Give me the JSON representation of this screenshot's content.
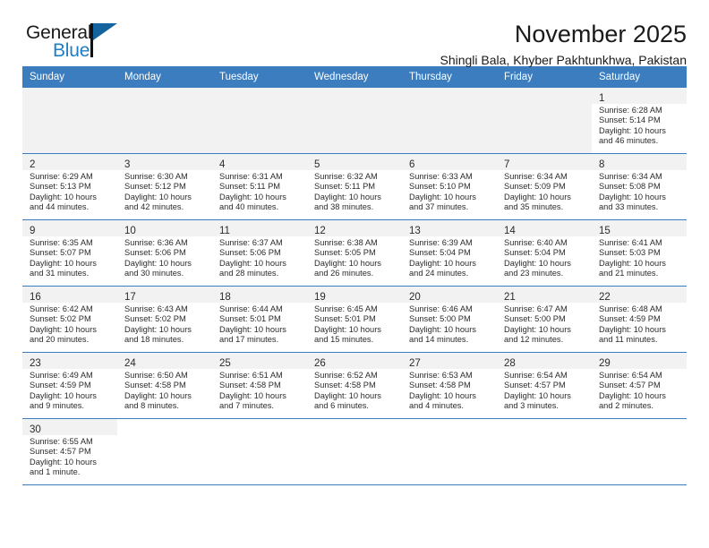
{
  "brand": {
    "word_one": "General",
    "word_two": "Blue",
    "flag_icon": "triangle-flag-icon",
    "colors": {
      "black": "#1a1a1a",
      "blue": "#1f7ec4",
      "flag": "#14639e"
    }
  },
  "header": {
    "title": "November 2025",
    "subtitle": "Shingli Bala, Khyber Pakhtunkhwa, Pakistan"
  },
  "theme": {
    "header_band": "#3b7dbf",
    "row_divider": "#3b7dbf",
    "daynum_strip": "#f2f2f2"
  },
  "weekdays": [
    "Sunday",
    "Monday",
    "Tuesday",
    "Wednesday",
    "Thursday",
    "Friday",
    "Saturday"
  ],
  "labels": {
    "sunrise_prefix": "Sunrise:",
    "sunset_prefix": "Sunset:",
    "daylight_prefix": "Daylight:"
  },
  "weeks": [
    [
      {
        "empty": true
      },
      {
        "empty": true
      },
      {
        "empty": true
      },
      {
        "empty": true
      },
      {
        "empty": true
      },
      {
        "empty": true
      },
      {
        "day": "1",
        "sunrise": "Sunrise: 6:28 AM",
        "sunset": "Sunset: 5:14 PM",
        "daylight_line1": "Daylight: 10 hours",
        "daylight_line2": "and 46 minutes."
      }
    ],
    [
      {
        "day": "2",
        "sunrise": "Sunrise: 6:29 AM",
        "sunset": "Sunset: 5:13 PM",
        "daylight_line1": "Daylight: 10 hours",
        "daylight_line2": "and 44 minutes."
      },
      {
        "day": "3",
        "sunrise": "Sunrise: 6:30 AM",
        "sunset": "Sunset: 5:12 PM",
        "daylight_line1": "Daylight: 10 hours",
        "daylight_line2": "and 42 minutes."
      },
      {
        "day": "4",
        "sunrise": "Sunrise: 6:31 AM",
        "sunset": "Sunset: 5:11 PM",
        "daylight_line1": "Daylight: 10 hours",
        "daylight_line2": "and 40 minutes."
      },
      {
        "day": "5",
        "sunrise": "Sunrise: 6:32 AM",
        "sunset": "Sunset: 5:11 PM",
        "daylight_line1": "Daylight: 10 hours",
        "daylight_line2": "and 38 minutes."
      },
      {
        "day": "6",
        "sunrise": "Sunrise: 6:33 AM",
        "sunset": "Sunset: 5:10 PM",
        "daylight_line1": "Daylight: 10 hours",
        "daylight_line2": "and 37 minutes."
      },
      {
        "day": "7",
        "sunrise": "Sunrise: 6:34 AM",
        "sunset": "Sunset: 5:09 PM",
        "daylight_line1": "Daylight: 10 hours",
        "daylight_line2": "and 35 minutes."
      },
      {
        "day": "8",
        "sunrise": "Sunrise: 6:34 AM",
        "sunset": "Sunset: 5:08 PM",
        "daylight_line1": "Daylight: 10 hours",
        "daylight_line2": "and 33 minutes."
      }
    ],
    [
      {
        "day": "9",
        "sunrise": "Sunrise: 6:35 AM",
        "sunset": "Sunset: 5:07 PM",
        "daylight_line1": "Daylight: 10 hours",
        "daylight_line2": "and 31 minutes."
      },
      {
        "day": "10",
        "sunrise": "Sunrise: 6:36 AM",
        "sunset": "Sunset: 5:06 PM",
        "daylight_line1": "Daylight: 10 hours",
        "daylight_line2": "and 30 minutes."
      },
      {
        "day": "11",
        "sunrise": "Sunrise: 6:37 AM",
        "sunset": "Sunset: 5:06 PM",
        "daylight_line1": "Daylight: 10 hours",
        "daylight_line2": "and 28 minutes."
      },
      {
        "day": "12",
        "sunrise": "Sunrise: 6:38 AM",
        "sunset": "Sunset: 5:05 PM",
        "daylight_line1": "Daylight: 10 hours",
        "daylight_line2": "and 26 minutes."
      },
      {
        "day": "13",
        "sunrise": "Sunrise: 6:39 AM",
        "sunset": "Sunset: 5:04 PM",
        "daylight_line1": "Daylight: 10 hours",
        "daylight_line2": "and 24 minutes."
      },
      {
        "day": "14",
        "sunrise": "Sunrise: 6:40 AM",
        "sunset": "Sunset: 5:04 PM",
        "daylight_line1": "Daylight: 10 hours",
        "daylight_line2": "and 23 minutes."
      },
      {
        "day": "15",
        "sunrise": "Sunrise: 6:41 AM",
        "sunset": "Sunset: 5:03 PM",
        "daylight_line1": "Daylight: 10 hours",
        "daylight_line2": "and 21 minutes."
      }
    ],
    [
      {
        "day": "16",
        "sunrise": "Sunrise: 6:42 AM",
        "sunset": "Sunset: 5:02 PM",
        "daylight_line1": "Daylight: 10 hours",
        "daylight_line2": "and 20 minutes."
      },
      {
        "day": "17",
        "sunrise": "Sunrise: 6:43 AM",
        "sunset": "Sunset: 5:02 PM",
        "daylight_line1": "Daylight: 10 hours",
        "daylight_line2": "and 18 minutes."
      },
      {
        "day": "18",
        "sunrise": "Sunrise: 6:44 AM",
        "sunset": "Sunset: 5:01 PM",
        "daylight_line1": "Daylight: 10 hours",
        "daylight_line2": "and 17 minutes."
      },
      {
        "day": "19",
        "sunrise": "Sunrise: 6:45 AM",
        "sunset": "Sunset: 5:01 PM",
        "daylight_line1": "Daylight: 10 hours",
        "daylight_line2": "and 15 minutes."
      },
      {
        "day": "20",
        "sunrise": "Sunrise: 6:46 AM",
        "sunset": "Sunset: 5:00 PM",
        "daylight_line1": "Daylight: 10 hours",
        "daylight_line2": "and 14 minutes."
      },
      {
        "day": "21",
        "sunrise": "Sunrise: 6:47 AM",
        "sunset": "Sunset: 5:00 PM",
        "daylight_line1": "Daylight: 10 hours",
        "daylight_line2": "and 12 minutes."
      },
      {
        "day": "22",
        "sunrise": "Sunrise: 6:48 AM",
        "sunset": "Sunset: 4:59 PM",
        "daylight_line1": "Daylight: 10 hours",
        "daylight_line2": "and 11 minutes."
      }
    ],
    [
      {
        "day": "23",
        "sunrise": "Sunrise: 6:49 AM",
        "sunset": "Sunset: 4:59 PM",
        "daylight_line1": "Daylight: 10 hours",
        "daylight_line2": "and 9 minutes."
      },
      {
        "day": "24",
        "sunrise": "Sunrise: 6:50 AM",
        "sunset": "Sunset: 4:58 PM",
        "daylight_line1": "Daylight: 10 hours",
        "daylight_line2": "and 8 minutes."
      },
      {
        "day": "25",
        "sunrise": "Sunrise: 6:51 AM",
        "sunset": "Sunset: 4:58 PM",
        "daylight_line1": "Daylight: 10 hours",
        "daylight_line2": "and 7 minutes."
      },
      {
        "day": "26",
        "sunrise": "Sunrise: 6:52 AM",
        "sunset": "Sunset: 4:58 PM",
        "daylight_line1": "Daylight: 10 hours",
        "daylight_line2": "and 6 minutes."
      },
      {
        "day": "27",
        "sunrise": "Sunrise: 6:53 AM",
        "sunset": "Sunset: 4:58 PM",
        "daylight_line1": "Daylight: 10 hours",
        "daylight_line2": "and 4 minutes."
      },
      {
        "day": "28",
        "sunrise": "Sunrise: 6:54 AM",
        "sunset": "Sunset: 4:57 PM",
        "daylight_line1": "Daylight: 10 hours",
        "daylight_line2": "and 3 minutes."
      },
      {
        "day": "29",
        "sunrise": "Sunrise: 6:54 AM",
        "sunset": "Sunset: 4:57 PM",
        "daylight_line1": "Daylight: 10 hours",
        "daylight_line2": "and 2 minutes."
      }
    ],
    [
      {
        "day": "30",
        "sunrise": "Sunrise: 6:55 AM",
        "sunset": "Sunset: 4:57 PM",
        "daylight_line1": "Daylight: 10 hours",
        "daylight_line2": "and 1 minute."
      },
      {
        "blank": true
      },
      {
        "blank": true
      },
      {
        "blank": true
      },
      {
        "blank": true
      },
      {
        "blank": true
      },
      {
        "blank": true
      }
    ]
  ]
}
